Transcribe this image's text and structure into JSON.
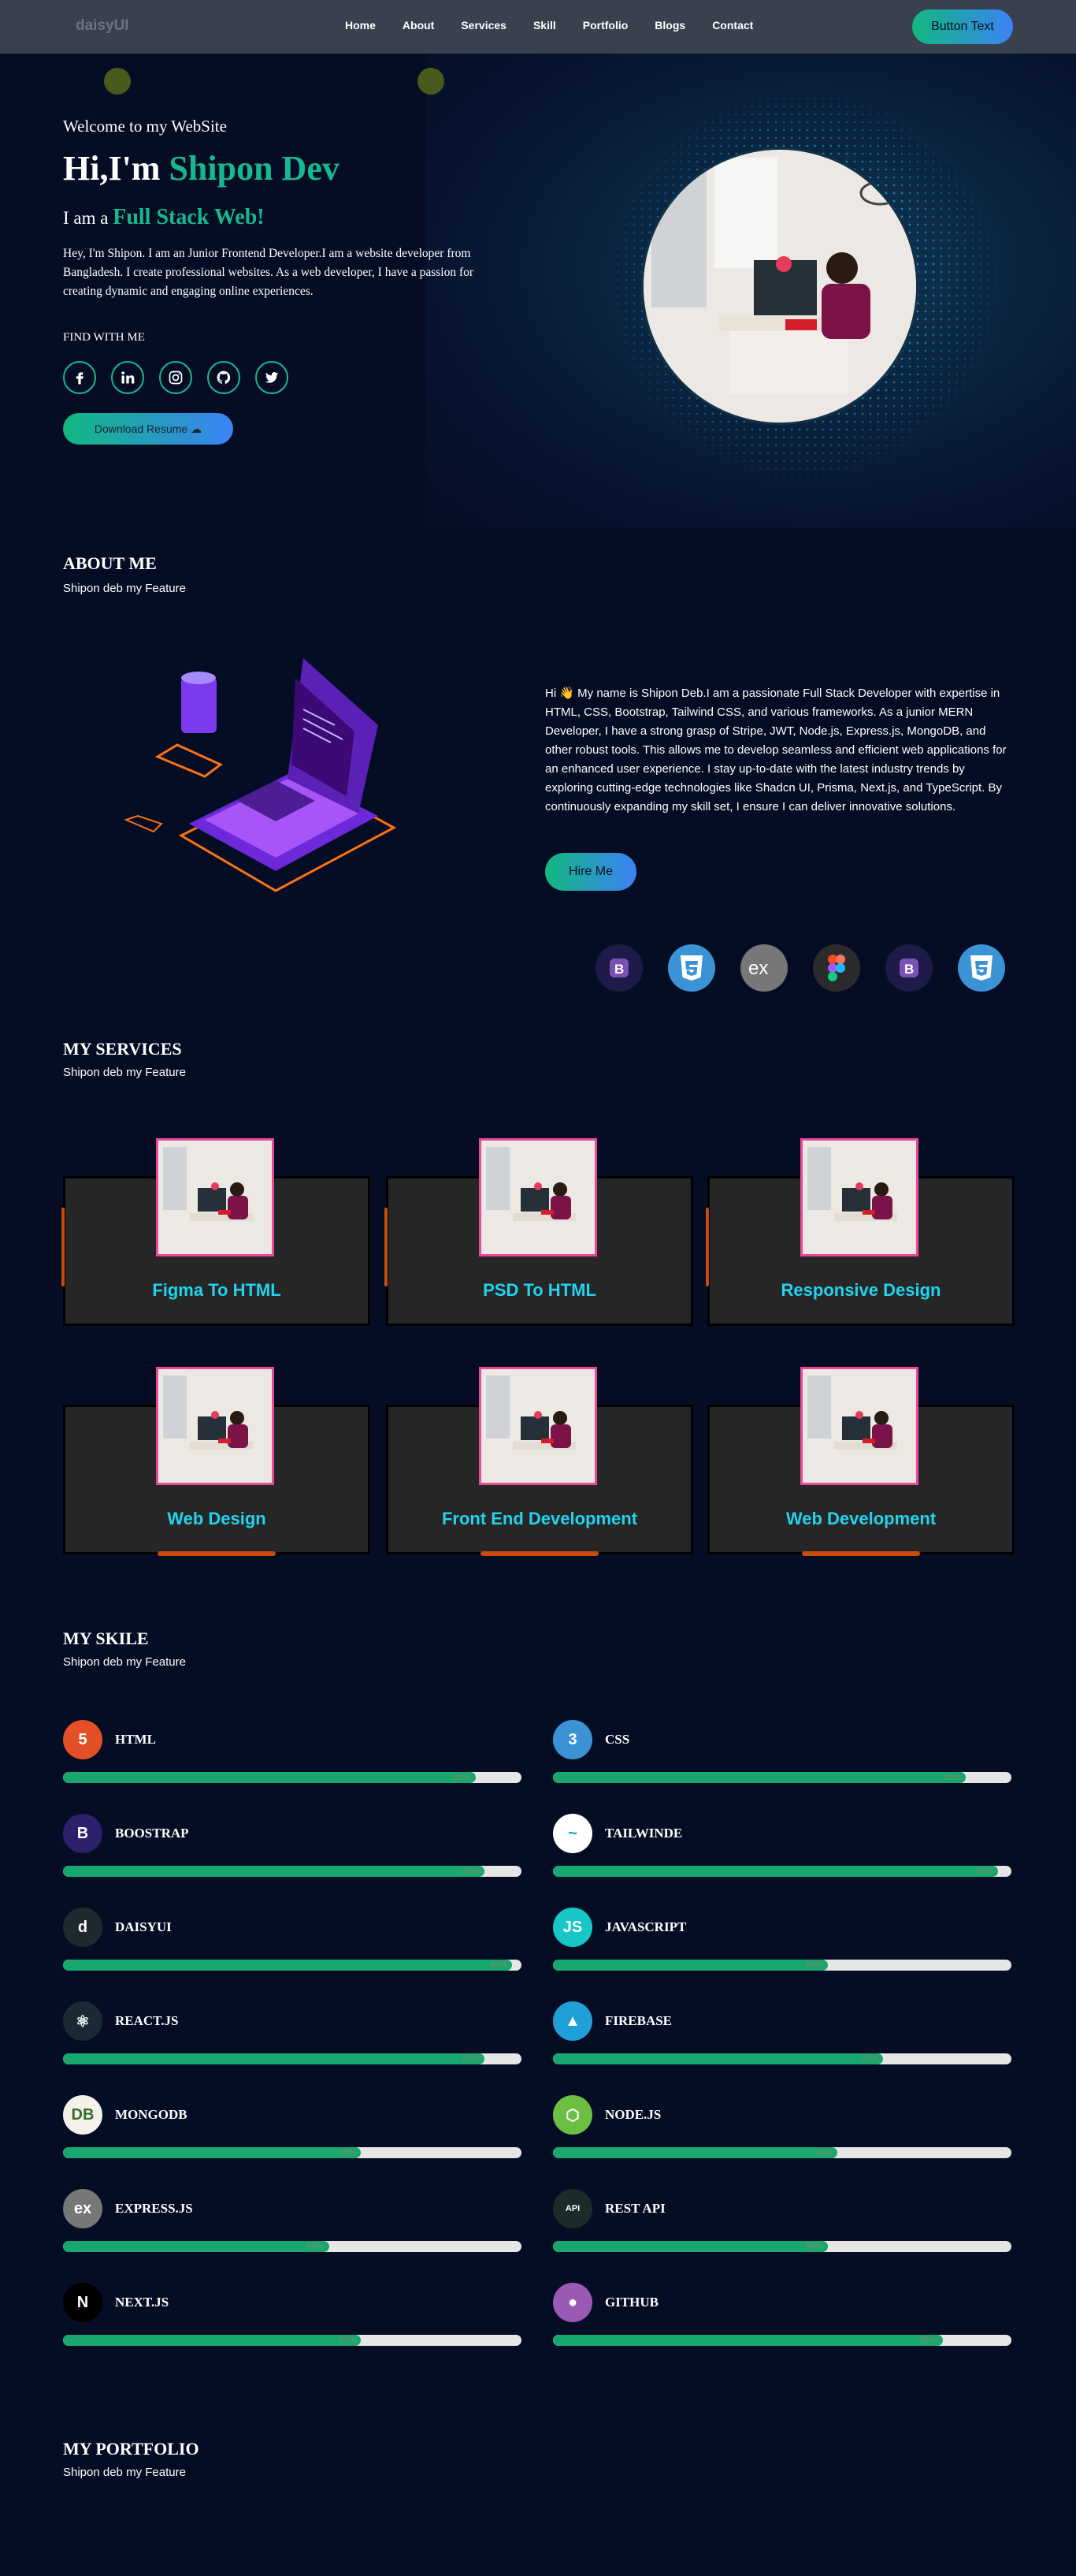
{
  "nav": {
    "logo": "daisyUI",
    "links": [
      "Home",
      "About",
      "Services",
      "Skill",
      "Portfolio",
      "Blogs",
      "Contact"
    ],
    "button": "Button Text"
  },
  "hero": {
    "welcome": "Welcome to my WebSite",
    "hi": "Hi,I'm",
    "name": "Shipon Dev",
    "iam": "I am a",
    "role": "Full Stack Web!",
    "description": "Hey, I'm Shipon. I am an Junior Frontend Developer.I am a website developer from Bangladesh. I create professional websites. As a web developer, I have a passion for creating dynamic and engaging online experiences.",
    "find": "FIND WITH ME",
    "socials": [
      "facebook-icon",
      "linkedin-icon",
      "instagram-icon",
      "github-icon",
      "twitter-icon"
    ],
    "download": "Download Resume ☁"
  },
  "about": {
    "title": "ABOUT ME",
    "subtitle": "Shipon deb my Feature",
    "text": "Hi 👋 My name is Shipon Deb.I am a passionate Full Stack Developer with expertise in HTML, CSS, Bootstrap, Tailwind CSS, and various frameworks. As a junior MERN Developer, I have a strong grasp of Stripe, JWT, Node.js, Express.js, MongoDB, and other robust tools. This allows me to develop seamless and efficient web applications for an enhanced user experience. I stay up-to-date with the latest industry trends by exploring cutting-edge technologies like Shadcn UI, Prisma, Next.js, and TypeScript. By continuously expanding my skill set, I ensure I can deliver innovative solutions.",
    "hire": "Hire Me",
    "tech_icons": [
      "bootstrap-icon",
      "css3-icon",
      "express-icon",
      "figma-icon",
      "bootstrap-icon",
      "css3-icon"
    ]
  },
  "services": {
    "title": "MY SERVICES",
    "subtitle": "Shipon deb my Feature",
    "items": [
      "Figma To HTML",
      "PSD To HTML",
      "Responsive Design",
      "Web Design",
      "Front End Development",
      "Web Development"
    ]
  },
  "skills": {
    "title": "MY SKILE",
    "subtitle": "Shipon deb my Feature",
    "items": [
      {
        "name": "HTML",
        "pct": "90%",
        "value": 0.9,
        "icon": "html5-icon"
      },
      {
        "name": "CSS",
        "pct": "90%",
        "value": 0.9,
        "icon": "css3-icon"
      },
      {
        "name": "BOOSTRAP",
        "pct": "92%",
        "value": 0.92,
        "icon": "bootstrap-icon"
      },
      {
        "name": "TAILWINDE",
        "pct": "97%",
        "value": 0.97,
        "icon": "tailwind-icon"
      },
      {
        "name": "DAISYUI",
        "pct": "98%",
        "value": 0.98,
        "icon": "daisyui-icon"
      },
      {
        "name": "JAVASCRIPT",
        "pct": "60%",
        "value": 0.6,
        "icon": "javascript-icon"
      },
      {
        "name": "REACT.JS",
        "pct": "92%",
        "value": 0.92,
        "icon": "react-icon"
      },
      {
        "name": "FIREBASE",
        "pct": "72%",
        "value": 0.72,
        "icon": "firebase-icon"
      },
      {
        "name": "MONGODB",
        "pct": "65%",
        "value": 0.65,
        "icon": "mongodb-icon"
      },
      {
        "name": "NODE.JS",
        "pct": "62%",
        "value": 0.62,
        "icon": "nodejs-icon"
      },
      {
        "name": "EXPRESS.JS",
        "pct": "58%",
        "value": 0.58,
        "icon": "express-icon"
      },
      {
        "name": "REST API",
        "pct": "60%",
        "value": 0.6,
        "icon": "api-icon"
      },
      {
        "name": "NEXT.JS",
        "pct": "65%",
        "value": 0.65,
        "icon": "nextjs-icon"
      },
      {
        "name": "GITHUB",
        "pct": "85%",
        "value": 0.85,
        "icon": "github-icon"
      }
    ]
  },
  "portfolio": {
    "title": "MY PORTFOLIO",
    "subtitle": "Shipon deb my Feature"
  },
  "colors": {
    "background": "#050d24",
    "accent": "#17b890",
    "service_label": "#22d3ee",
    "bar_fill": "#18a86e"
  }
}
